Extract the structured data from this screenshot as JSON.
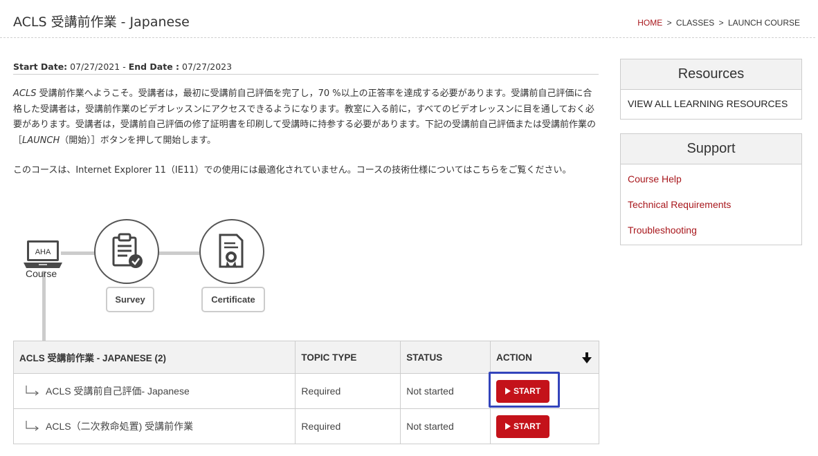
{
  "header": {
    "title": "ACLS 受講前作業 - Japanese",
    "breadcrumb": {
      "home": "HOME",
      "classes": "CLASSES",
      "current": "LAUNCH COURSE",
      "separator": ">"
    }
  },
  "dates": {
    "start_label": "Start Date:",
    "start_value": "07/27/2021",
    "dash": "-",
    "end_label": "End Date :",
    "end_value": "07/27/2023"
  },
  "intro": {
    "p1_italic": "ACLS",
    "p1_a": " 受講前作業へようこそ。受講者は，最初に受講前自己評価を完了し，70 %以上の正答率を達成する必要があります。受講前自己評価に合格した受講者は，受講前作業のビデオレッスンにアクセスできるようになります。教室に入る前に，すべてのビデオレッスンに目を通しておく必要があります。受講者は，受講前自己評価の修了証明書を印刷して受講時に持参する必要があります。下記の受講前自己評価または受講前作業の［",
    "p1_italic2": "LAUNCH",
    "p1_b": "（開始）］ボタンを押して開始します。",
    "p2_a": "このコースは、Internet Explorer 11（IE11）での使用には最適化されていません。コースの技術仕様については",
    "p2_link": "こちら",
    "p2_b": "をご覧ください。"
  },
  "path": {
    "laptop_text": "AHA",
    "course_label": "Course",
    "survey_label": "Survey",
    "certificate_label": "Certificate"
  },
  "table": {
    "headers": [
      "ACLS 受講前作業 - JAPANESE (2)",
      "TOPIC TYPE",
      "STATUS",
      "ACTION"
    ],
    "rows": [
      {
        "topic": "ACLS 受講前自己評価- Japanese",
        "type": "Required",
        "status": "Not started",
        "action": "START"
      },
      {
        "topic": "ACLS（二次救命処置) 受講前作業",
        "type": "Required",
        "status": "Not started",
        "action": "START"
      }
    ]
  },
  "resources": {
    "title": "Resources",
    "link": "VIEW ALL LEARNING RESOURCES"
  },
  "support": {
    "title": "Support",
    "links": [
      "Course Help",
      "Technical Requirements",
      "Troubleshooting"
    ]
  },
  "colors": {
    "brand_red": "#c4121a",
    "link_red": "#a8171c",
    "highlight_blue": "#3344bb"
  }
}
